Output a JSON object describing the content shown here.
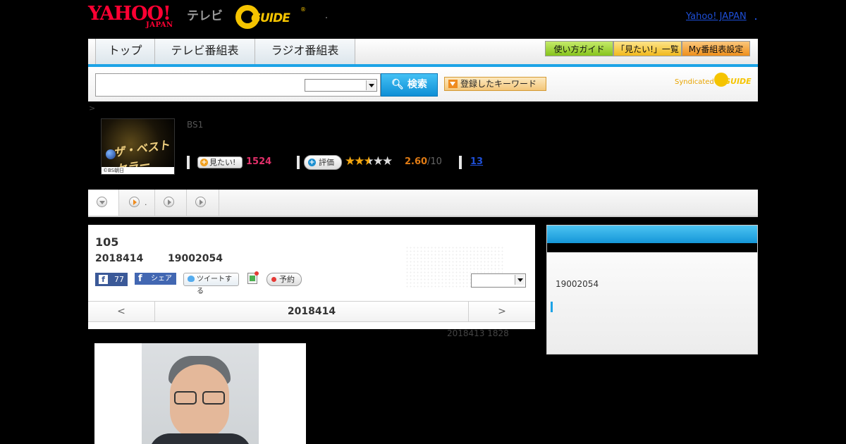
{
  "header": {
    "yahoo_logo": "YAHOO!",
    "yahoo_sub": "JAPAN",
    "tv_label": "テレビ",
    "gguide_logo": "GUIDE",
    "gguide_reg": "®",
    "yahoo_japan_link": "Yahoo! JAPAN"
  },
  "nav": {
    "tabs": [
      "トップ",
      "テレビ番組表",
      "ラジオ番組表"
    ],
    "buttons": [
      "使い方ガイド",
      "「見たい!」一覧",
      "My番組表設定"
    ]
  },
  "search": {
    "button_label": "検索",
    "keyword_button": "登録したキーワード",
    "syndicated": "Syndicated",
    "syndicated_logo": "GUIDE"
  },
  "breadcrumb": ">",
  "program": {
    "thumb_title": "ザ・ベストセラー",
    "thumb_copyright": "©BS朝日",
    "channel": "BS1",
    "mitai_label": "見たい!",
    "mitai_count": "1524",
    "hyoka_label": "評価",
    "rating": "2.60",
    "rating_max": "/10",
    "rating_stars": 2.6,
    "comments": "13"
  },
  "subnav": {
    "tab2_suffix": "."
  },
  "episode": {
    "title": "105",
    "date": "2018414",
    "time": "19002054",
    "fb_like_count": "77",
    "fb_share": "シェア",
    "tweet": "ツイートする",
    "reserve": "予約",
    "pager_prev": "<",
    "pager_date": "2018414",
    "pager_next": ">",
    "updated": "2018413  1828"
  },
  "side": {
    "time": "19002054"
  },
  "colors": {
    "accent_blue": "#1da3e6",
    "mitai_pink": "#e2306a",
    "rating_orange": "#e07b14",
    "yahoo_red": "#ff0033",
    "gguide_yellow": "#f5c400"
  }
}
